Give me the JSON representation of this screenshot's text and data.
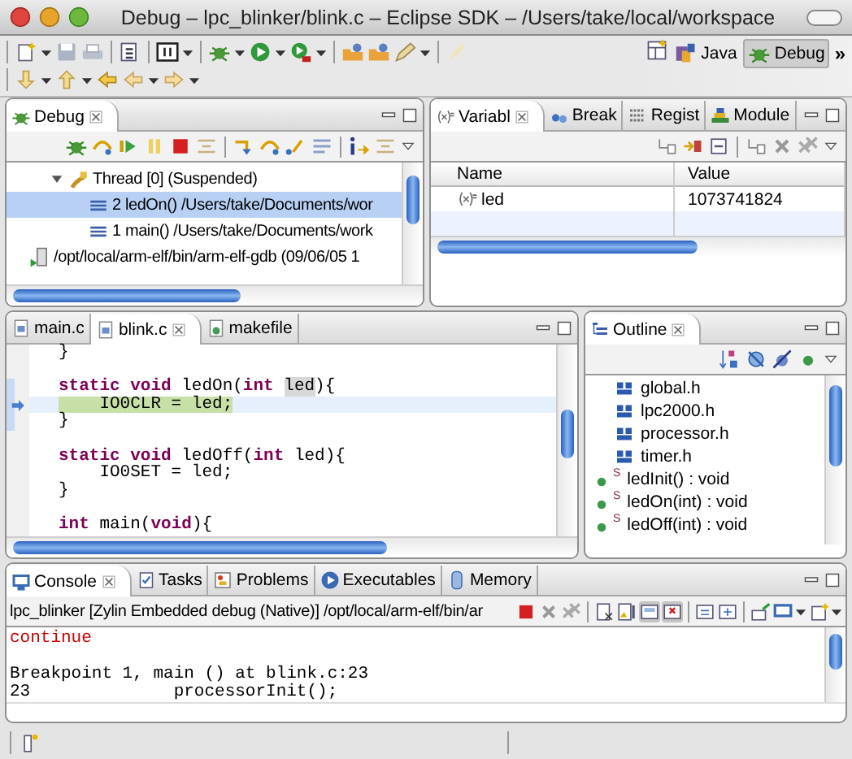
{
  "window": {
    "title": "Debug – lpc_blinker/blink.c – Eclipse SDK – /Users/take/local/workspace"
  },
  "perspectives": [
    {
      "label": "Java",
      "kind": "java",
      "selected": false
    },
    {
      "label": "Debug",
      "kind": "debug",
      "selected": true
    }
  ],
  "overflow": "»",
  "debug_view": {
    "tabs": [
      {
        "label": "Debug",
        "kind": "debug",
        "selected": true
      }
    ],
    "tree": [
      {
        "label": "Thread [0] (Suspended)",
        "kind": "thread",
        "expanded": true,
        "selected": false,
        "children": [
          {
            "label": "2 ledOn() /Users/take/Documents/wor",
            "kind": "frame",
            "selected": true
          },
          {
            "label": "1 main() /Users/take/Documents/work",
            "kind": "frame",
            "selected": false
          }
        ]
      },
      {
        "label": "/opt/local/arm-elf/bin/arm-elf-gdb (09/06/05 1",
        "kind": "process",
        "selected": false
      }
    ]
  },
  "variables_view": {
    "tabs": [
      {
        "label": "Variabl",
        "kind": "variables",
        "selected": true
      },
      {
        "label": "Break",
        "kind": "breakpoints",
        "selected": false
      },
      {
        "label": "Regist",
        "kind": "registers",
        "selected": false
      },
      {
        "label": "Module",
        "kind": "modules",
        "selected": false
      }
    ],
    "columns": [
      "Name",
      "Value"
    ],
    "rows": [
      {
        "name": "led",
        "value": "1073741824"
      }
    ]
  },
  "editor": {
    "tabs": [
      {
        "label": "main.c",
        "kind": "c-file",
        "selected": false
      },
      {
        "label": "blink.c",
        "kind": "c-file",
        "selected": true
      },
      {
        "label": "makefile",
        "kind": "makefile",
        "selected": false
      }
    ],
    "lines": [
      {
        "kind": "code",
        "segments": [
          {
            "text": "}",
            "kind": "plain"
          }
        ]
      },
      {
        "kind": "blank"
      },
      {
        "kind": "code",
        "in_range": true,
        "segments": [
          {
            "text": "static void",
            "kind": "keyword"
          },
          {
            "text": " ledOn(",
            "kind": "plain"
          },
          {
            "text": "int ",
            "kind": "keyword"
          },
          {
            "text": "led",
            "kind": "occurrence"
          },
          {
            "text": "){",
            "kind": "plain"
          }
        ]
      },
      {
        "kind": "code",
        "in_range": true,
        "current": true,
        "segments": [
          {
            "text": "    IO0CLR = led;",
            "kind": "plain"
          }
        ]
      },
      {
        "kind": "code",
        "in_range": true,
        "segments": [
          {
            "text": "}",
            "kind": "plain"
          }
        ]
      },
      {
        "kind": "blank"
      },
      {
        "kind": "code",
        "segments": [
          {
            "text": "static void",
            "kind": "keyword"
          },
          {
            "text": " ledOff(",
            "kind": "plain"
          },
          {
            "text": "int",
            "kind": "keyword"
          },
          {
            "text": " led){",
            "kind": "plain"
          }
        ]
      },
      {
        "kind": "code",
        "segments": [
          {
            "text": "    IO0SET = led;",
            "kind": "plain"
          }
        ]
      },
      {
        "kind": "code",
        "segments": [
          {
            "text": "}",
            "kind": "plain"
          }
        ]
      },
      {
        "kind": "blank"
      },
      {
        "kind": "code",
        "segments": [
          {
            "text": "int",
            "kind": "keyword"
          },
          {
            "text": " main(",
            "kind": "plain"
          },
          {
            "text": "void",
            "kind": "keyword"
          },
          {
            "text": "){",
            "kind": "plain"
          }
        ]
      }
    ]
  },
  "outline": {
    "tabs": [
      {
        "label": "Outline",
        "kind": "outline",
        "selected": true
      }
    ],
    "items": [
      {
        "label": "global.h",
        "kind": "include"
      },
      {
        "label": "lpc2000.h",
        "kind": "include"
      },
      {
        "label": "processor.h",
        "kind": "include"
      },
      {
        "label": "timer.h",
        "kind": "include"
      },
      {
        "label": "ledInit() : void",
        "kind": "function",
        "decorator": "S"
      },
      {
        "label": "ledOn(int) : void",
        "kind": "function",
        "decorator": "S"
      },
      {
        "label": "ledOff(int) : void",
        "kind": "function",
        "decorator": "S"
      }
    ]
  },
  "console": {
    "tabs": [
      {
        "label": "Console",
        "kind": "console",
        "selected": true
      },
      {
        "label": "Tasks",
        "kind": "tasks",
        "selected": false
      },
      {
        "label": "Problems",
        "kind": "problems",
        "selected": false
      },
      {
        "label": "Executables",
        "kind": "executables",
        "selected": false
      },
      {
        "label": "Memory",
        "kind": "memory",
        "selected": false
      }
    ],
    "launch": "lpc_blinker [Zylin Embedded debug (Native)] /opt/local/arm-elf/bin/ar",
    "show_on_stdout": true,
    "show_on_stderr": true,
    "input_lines": [
      "continue"
    ],
    "output_lines": [
      "Breakpoint 1, main () at blink.c:23",
      "23              processorInit();"
    ]
  }
}
